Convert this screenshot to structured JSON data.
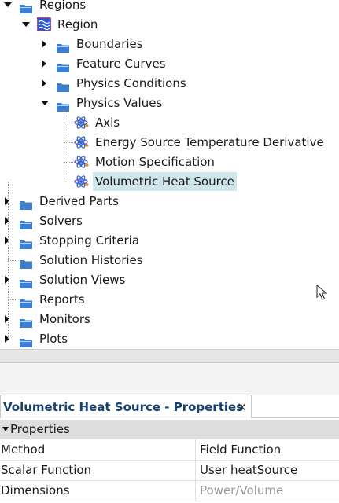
{
  "tree": {
    "items": [
      {
        "label": "Regions",
        "icon": "folder-icon",
        "expander": "down",
        "level": 0
      },
      {
        "label": "Region",
        "icon": "region-icon",
        "expander": "down",
        "level": 1
      },
      {
        "label": "Boundaries",
        "icon": "folder-icon",
        "expander": "right",
        "level": 2
      },
      {
        "label": "Feature Curves",
        "icon": "folder-icon",
        "expander": "right",
        "level": 2
      },
      {
        "label": "Physics Conditions",
        "icon": "folder-icon",
        "expander": "right",
        "level": 2
      },
      {
        "label": "Physics Values",
        "icon": "folder-icon",
        "expander": "down",
        "level": 2
      },
      {
        "label": "Axis",
        "icon": "physics-value-icon",
        "expander": "none",
        "level": 3
      },
      {
        "label": "Energy Source Temperature Derivative",
        "icon": "physics-value-icon",
        "expander": "none",
        "level": 3
      },
      {
        "label": "Motion Specification",
        "icon": "physics-value-icon",
        "expander": "none",
        "level": 3
      },
      {
        "label": "Volumetric Heat Source",
        "icon": "physics-value-icon",
        "expander": "none",
        "level": 3,
        "selected": true
      },
      {
        "label": "Derived Parts",
        "icon": "folder-icon",
        "expander": "right",
        "level": 0
      },
      {
        "label": "Solvers",
        "icon": "folder-icon",
        "expander": "right",
        "level": 0
      },
      {
        "label": "Stopping Criteria",
        "icon": "folder-icon",
        "expander": "right",
        "level": 0
      },
      {
        "label": "Solution Histories",
        "icon": "folder-icon",
        "expander": "none",
        "level": 0
      },
      {
        "label": "Solution Views",
        "icon": "folder-icon",
        "expander": "right",
        "level": 0
      },
      {
        "label": "Reports",
        "icon": "folder-icon",
        "expander": "none",
        "level": 0
      },
      {
        "label": "Monitors",
        "icon": "folder-icon",
        "expander": "right",
        "level": 0
      },
      {
        "label": "Plots",
        "icon": "folder-icon",
        "expander": "right",
        "level": 0
      }
    ]
  },
  "properties": {
    "tab_title": "Volumetric Heat Source - Properties",
    "close_glyph": "×",
    "section_label": "Properties",
    "rows": [
      {
        "key": "Method",
        "value": "Field Function",
        "dim": false
      },
      {
        "key": "Scalar Function",
        "value": "User heatSource",
        "dim": false
      },
      {
        "key": "Dimensions",
        "value": "Power/Volume",
        "dim": true
      }
    ]
  },
  "colors": {
    "folder": "#3a7fd5",
    "selection": "#cfe6ec",
    "tab_title": "#16416e",
    "region_icon": "#2f58d6"
  }
}
